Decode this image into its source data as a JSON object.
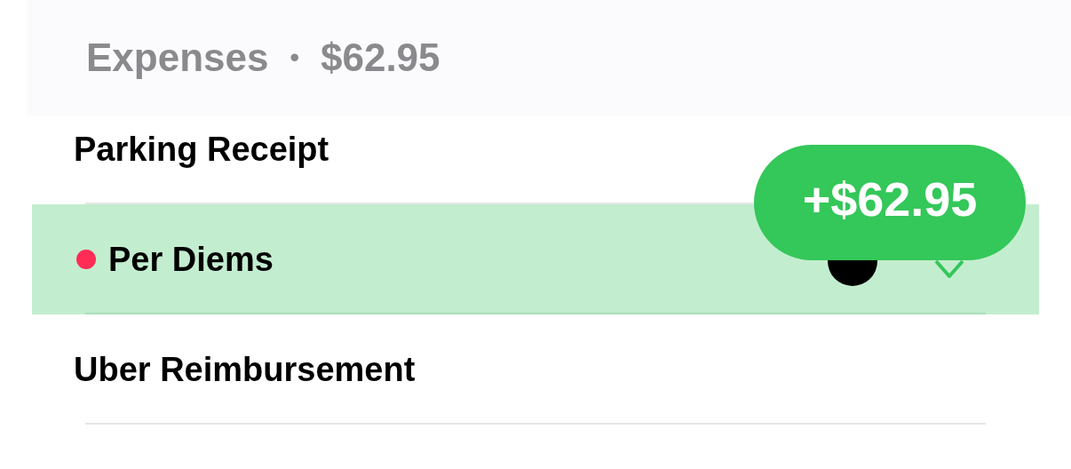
{
  "header": {
    "title": "Expenses",
    "separator": "•",
    "total": "$62.95"
  },
  "rows": [
    {
      "name": "Parking Receipt",
      "selected": false
    },
    {
      "name": "Per Diems",
      "selected": true,
      "color": "#ff2d55",
      "avatar": true
    },
    {
      "name": "Uber Reimbursement",
      "selected": false
    }
  ],
  "tooltip": {
    "text": "+$62.95"
  }
}
